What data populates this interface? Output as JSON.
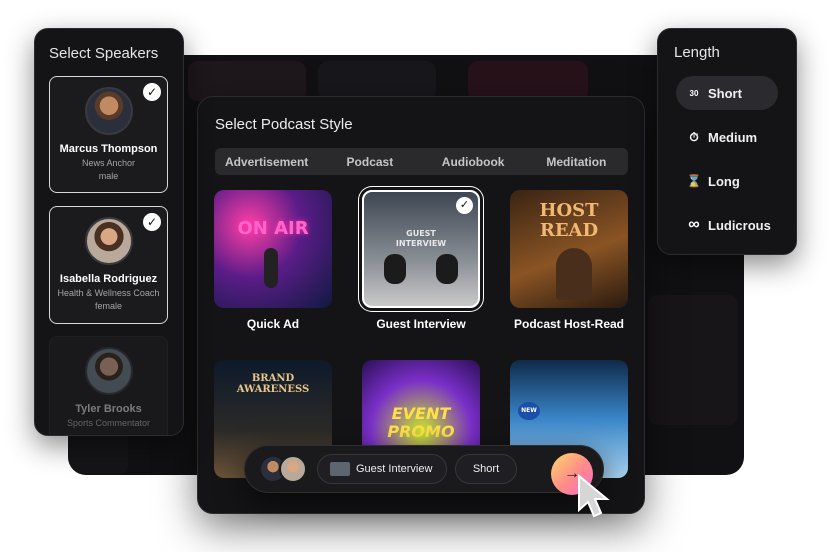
{
  "speakers": {
    "title": "Select Speakers",
    "items": [
      {
        "name": "Marcus Thompson",
        "role": "News Anchor",
        "gender": "male",
        "selected": true
      },
      {
        "name": "Isabella Rodriguez",
        "role": "Health & Wellness Coach",
        "gender": "female",
        "selected": true
      },
      {
        "name": "Tyler Brooks",
        "role": "Sports Commentator",
        "selected": false
      }
    ]
  },
  "style": {
    "title": "Select Podcast Style",
    "tabs": [
      "Advertisement",
      "Podcast",
      "Audiobook",
      "Meditation"
    ],
    "thumbs": [
      {
        "label": "Quick Ad",
        "art": "ON AIR"
      },
      {
        "label": "Guest Interview",
        "art_line1": "GUEST",
        "art_line2": "INTERVIEW",
        "selected": true
      },
      {
        "label": "Podcast Host-Read",
        "art_line1": "HOST",
        "art_line2": "READ"
      },
      {
        "art_line1": "BRAND",
        "art_line2": "AWARENESS"
      },
      {
        "art_line1": "EVENT",
        "art_line2": "PROMO"
      },
      {
        "art": "NEW"
      }
    ]
  },
  "summary": {
    "style_label": "Guest Interview",
    "length_label": "Short",
    "go_icon": "→"
  },
  "length": {
    "title": "Length",
    "options": [
      {
        "label": "Short",
        "icon": "30",
        "active": true
      },
      {
        "label": "Medium",
        "icon": "⏱"
      },
      {
        "label": "Long",
        "icon": "⌛"
      },
      {
        "label": "Ludicrous",
        "icon": "∞"
      }
    ]
  }
}
